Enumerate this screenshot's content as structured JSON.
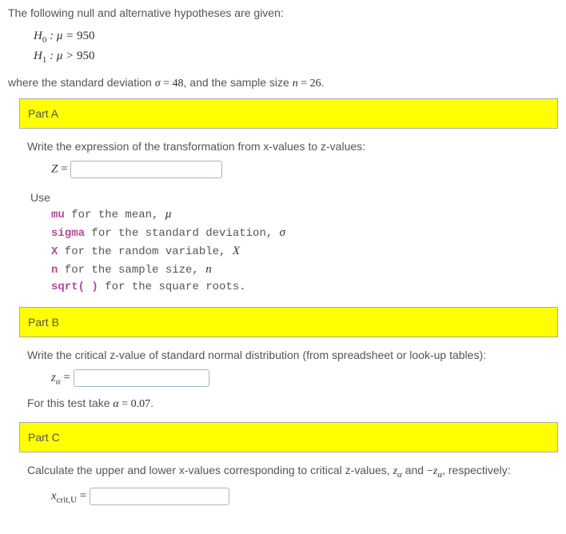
{
  "intro": "The following null and alternative hypotheses are given:",
  "hypotheses": {
    "h0_lhs": "H",
    "h0_sub": "0",
    "h0_mid": " : μ = ",
    "h0_val": "950",
    "h1_lhs": "H",
    "h1_sub": "1",
    "h1_mid": " : μ > ",
    "h1_val": "950"
  },
  "where": {
    "pre": "where the standard deviation ",
    "sigma": "σ",
    "eq1": " = ",
    "sigma_val": "48",
    "mid": ", and the sample size ",
    "n": "n",
    "eq2": " = ",
    "n_val": "26",
    "end": "."
  },
  "partA": {
    "title": "Part A",
    "prompt": "Write the expression of the transformation from x-values to z-values:",
    "zlabel": "Z",
    "eq": " = ",
    "use_title": "Use",
    "lines": {
      "l1_kw": "mu",
      "l1_txt": " for the mean, ",
      "l1_sym": "μ",
      "l2_kw": "sigma",
      "l2_txt": " for the standard deviation, ",
      "l2_sym": "σ",
      "l3_kw": "X",
      "l3_txt": " for the random variable, ",
      "l3_sym": "X",
      "l4_kw": "n",
      "l4_txt": " for the sample size, ",
      "l4_sym": "n",
      "l5_kw1": "sqrt(",
      "l5_mid": "   ",
      "l5_kw2": ")",
      "l5_txt": " for the square roots."
    }
  },
  "partB": {
    "title": "Part B",
    "prompt": "Write the critical z-value of standard normal distribution (from spreadsheet or look-up tables):",
    "zlabel": "z",
    "zsub": "α",
    "eq": " = ",
    "alpha_pre": "For this test take ",
    "alpha_sym": "α",
    "alpha_eq": " = ",
    "alpha_val": "0.07",
    "alpha_end": "."
  },
  "partC": {
    "title": "Part C",
    "prompt_pre": "Calculate the upper and lower x-values corresponding to critical z-values, ",
    "za1": "z",
    "za1_sub": "α",
    "prompt_mid": " and ",
    "neg": "−",
    "za2": "z",
    "za2_sub": "α",
    "prompt_end": ", respectively:",
    "xlabel": "x",
    "xsub": "crit,U",
    "eq": " = "
  }
}
